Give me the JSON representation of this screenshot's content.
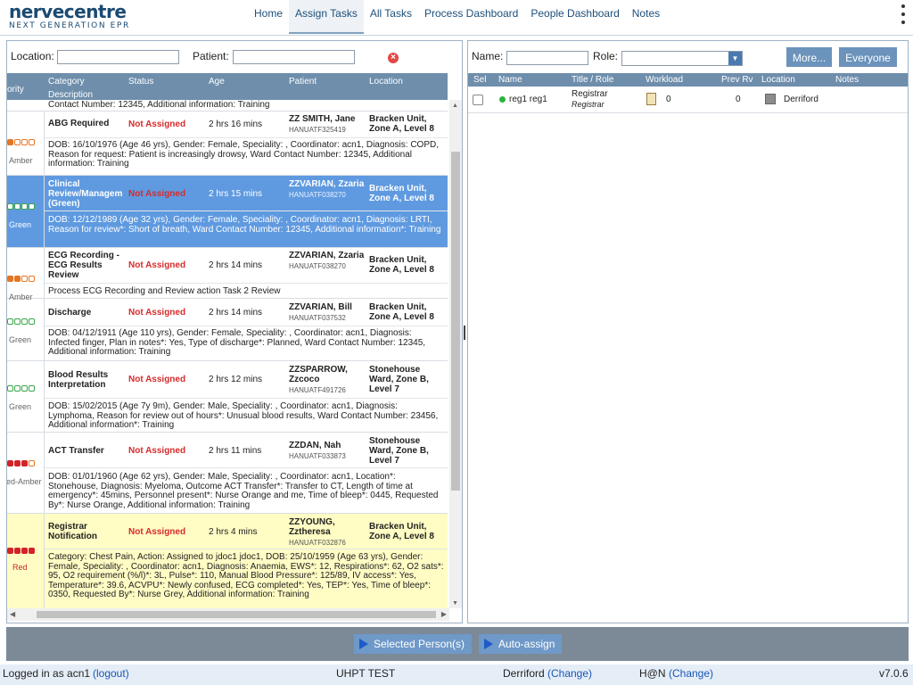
{
  "app": {
    "logo_main": "nervecentre",
    "logo_sub": "NEXT GENERATION EPR"
  },
  "nav": [
    {
      "label": "Home"
    },
    {
      "label": "Assign Tasks"
    },
    {
      "label": "All Tasks"
    },
    {
      "label": "Process Dashboard"
    },
    {
      "label": "People Dashboard"
    },
    {
      "label": "Notes"
    }
  ],
  "left_filter": {
    "location_label": "Location:",
    "location_value": "",
    "patient_label": "Patient:",
    "patient_value": ""
  },
  "task_table": {
    "headers": {
      "priority": "ority",
      "category": "Category",
      "status": "Status",
      "age": "Age",
      "patient": "Patient",
      "location": "Location",
      "description": "Description"
    },
    "top_partial_desc": "Contact Number: 12345, Additional information: Training",
    "rows": [
      {
        "priority_label": "Amber",
        "category": "ABG Required",
        "status": "Not Assigned",
        "age": "2 hrs 16 mins",
        "patient_name": "ZZ SMITH, Jane",
        "patient_id": "HANUATF325419",
        "location": "Bracken Unit, Zone A, Level 8",
        "description": "DOB: 16/10/1976 (Age 46 yrs), Gender: Female, Speciality: , Coordinator: acn1, Diagnosis: COPD, Reason for request: Patient is increasingly drowsy, Ward Contact Number: 12345, Additional information: Training"
      },
      {
        "priority_label": "Green",
        "category": "Clinical Review/Managem (Green)",
        "status": "Not Assigned",
        "age": "2 hrs 15 mins",
        "patient_name": "ZZVARIAN, Zzaria",
        "patient_id": "HANUATF038270",
        "location": "Bracken Unit, Zone A, Level 8",
        "description": "DOB: 12/12/1989 (Age 32 yrs), Gender: Female, Speciality: , Coordinator: acn1, Diagnosis: LRTI, Reason for review*: Short of breath, Ward Contact Number: 12345, Additional information*: Training"
      },
      {
        "priority_label": "Amber",
        "category": "ECG Recording - ECG Results Review",
        "status": "Not Assigned",
        "age": "2 hrs 14 mins",
        "patient_name": "ZZVARIAN, Zzaria",
        "patient_id": "HANUATF038270",
        "location": "Bracken Unit, Zone A, Level 8",
        "description": "Process ECG Recording and Review action Task 2 Review"
      },
      {
        "priority_label": "Green",
        "category": "Discharge",
        "status": "Not Assigned",
        "age": "2 hrs 14 mins",
        "patient_name": "ZZVARIAN, Bill",
        "patient_id": "HANUATF037532",
        "location": "Bracken Unit, Zone A, Level 8",
        "description": "DOB: 04/12/1911 (Age 110 yrs), Gender: Female, Speciality: , Coordinator: acn1, Diagnosis: Infected finger, Plan in notes*: Yes, Type of discharge*: Planned, Ward Contact Number: 12345, Additional information: Training"
      },
      {
        "priority_label": "Green",
        "category": "Blood Results Interpretation",
        "status": "Not Assigned",
        "age": "2 hrs 12 mins",
        "patient_name": "ZZSPARROW, Zzcoco",
        "patient_id": "HANUATF491726",
        "location": "Stonehouse Ward, Zone B, Level 7",
        "description": "DOB: 15/02/2015 (Age 7y 9m), Gender: Male, Speciality: , Coordinator: acn1, Diagnosis: Lymphoma, Reason for review out of hours*: Unusual blood results, Ward Contact Number: 23456, Additional information*: Training"
      },
      {
        "priority_label": "ed-Amber",
        "category": "ACT Transfer",
        "status": "Not Assigned",
        "age": "2 hrs 11 mins",
        "patient_name": "ZZDAN, Nah",
        "patient_id": "HANUATF033873",
        "location": "Stonehouse Ward, Zone B, Level 7",
        "description": "DOB: 01/01/1960 (Age 62 yrs), Gender: Male, Speciality: , Coordinator: acn1, Location*: Stonehouse, Diagnosis: Myeloma, Outcome ACT Transfer*: Transfer to CT, Length of time at emergency*: 45mins, Personnel present*: Nurse Orange and me, Time of bleep*: 0445, Requested By*: Nurse Orange, Additional information: Training"
      },
      {
        "priority_label": "Red",
        "category": "Registrar Notification",
        "status": "Not Assigned",
        "age": "2 hrs 4 mins",
        "patient_name": "ZZYOUNG, Zztheresa",
        "patient_id": "HANUATF032876",
        "location": "Bracken Unit, Zone A, Level 8",
        "description": "Category: Chest Pain, Action: Assigned to jdoc1 jdoc1, DOB: 25/10/1959 (Age 63 yrs), Gender: Female, Speciality: , Coordinator: acn1, Diagnosis: Anaemia, EWS*: 12, Respirations*: 62, O2 sats*: 95, O2 requirement (%/l)*: 3L, Pulse*: 110, Manual Blood Pressure*: 125/89, IV access*: Yes, Temperature*: 39.6, ACVPU*: Newly confused, ECG completed*: Yes, TEP*: Yes, Time of bleep*: 0350, Requested By*: Nurse Grey, Additional information: Training"
      }
    ]
  },
  "right_filter": {
    "name_label": "Name:",
    "name_value": "",
    "role_label": "Role:",
    "role_value": "",
    "more_button": "More...",
    "everyone_button": "Everyone"
  },
  "people_table": {
    "headers": {
      "sel": "Sel",
      "name": "Name",
      "title_role": "Title / Role",
      "workload": "Workload",
      "prev_rv": "Prev Rv",
      "location": "Location",
      "notes": "Notes"
    },
    "rows": [
      {
        "name": "reg1 reg1",
        "title": "Registrar",
        "role": "Registrar",
        "workload": "0",
        "prev_rv": "0",
        "location": "Derriford",
        "notes": ""
      }
    ]
  },
  "actions": {
    "selected_persons": "Selected Person(s)",
    "auto_assign": "Auto-assign"
  },
  "status_bar": {
    "logged_in": "Logged in as acn1",
    "logout": "(logout)",
    "org": "UHPT TEST",
    "site": "Derriford",
    "site_change": "(Change)",
    "mode": "H@N",
    "mode_change": "(Change)",
    "version": "v7.0.6"
  },
  "colors": {
    "header_blue": "#6e8eac",
    "selected_row": "#5f9ae0",
    "highlight_row": "#fffcc4",
    "status_red": "#d62b2b",
    "amber": "#e67522",
    "green": "#3aa64a",
    "red": "#d2232a"
  }
}
